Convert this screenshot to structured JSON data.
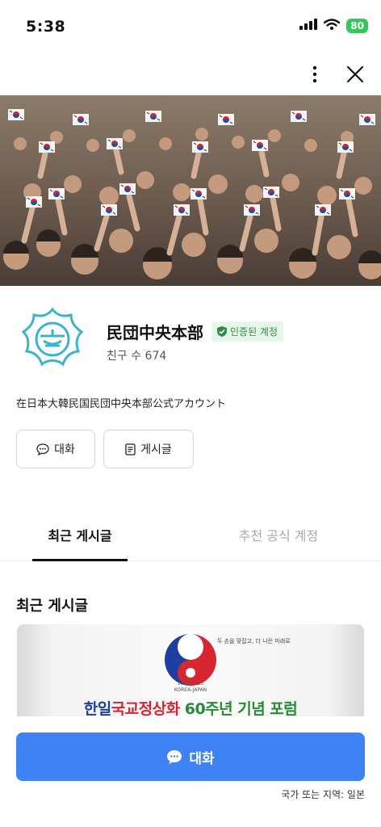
{
  "status_bar": {
    "time": "5:38",
    "battery": "80"
  },
  "profile": {
    "name": "民団中央本部",
    "verified_label": "인증된 계정",
    "friends": "친구 수 674",
    "description": "在日本大韓民国民団中央本部公式アカウント"
  },
  "actions": {
    "chat_label": "대화",
    "posts_label": "게시글"
  },
  "tabs": {
    "recent": "최근 게시글",
    "recommended": "추천 공식 계정"
  },
  "recent_section": {
    "title": "최근 게시글"
  },
  "post": {
    "banner_slogan": "두 손을 맞잡고, 더 나은 미래로",
    "banner_years": "1965-2025",
    "banner_country": "KOREA-JAPAN",
    "headline_part1": "한일",
    "headline_part2": "국교정상화",
    "headline_part3": "60주년 기념 포럼"
  },
  "cta": {
    "label": "대화"
  },
  "footer": {
    "region": "국가 또는 지역: 일본"
  },
  "colors": {
    "accent": "#3d83f5",
    "verified_green": "#2f8a45",
    "battery_green": "#34c759"
  }
}
